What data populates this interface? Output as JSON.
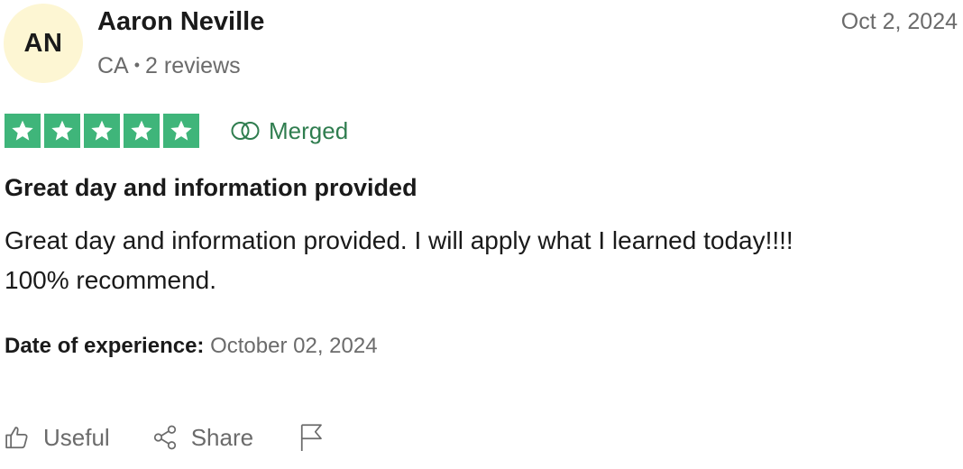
{
  "reviewer": {
    "initials": "AN",
    "name": "Aaron Neville",
    "country": "CA",
    "separator": "•",
    "review_count": "2 reviews",
    "avatar_color": "#fdf6d3"
  },
  "review": {
    "date": "Oct 2, 2024",
    "rating": 5,
    "rating_max": 5,
    "star_color": "#3fb57a",
    "badge": {
      "label": "Merged",
      "icon": "merged-rings-icon",
      "color": "#2f7d4f"
    },
    "title": "Great day and information provided",
    "body_lines": [
      "Great day and information provided. I will apply what I learned today!!!!",
      "100% recommend."
    ],
    "experience_label": "Date of experience:",
    "experience_date": "October 02, 2024"
  },
  "actions": {
    "useful_label": "Useful",
    "useful_icon": "thumbs-up-icon",
    "share_label": "Share",
    "share_icon": "share-icon",
    "flag_icon": "flag-icon"
  }
}
